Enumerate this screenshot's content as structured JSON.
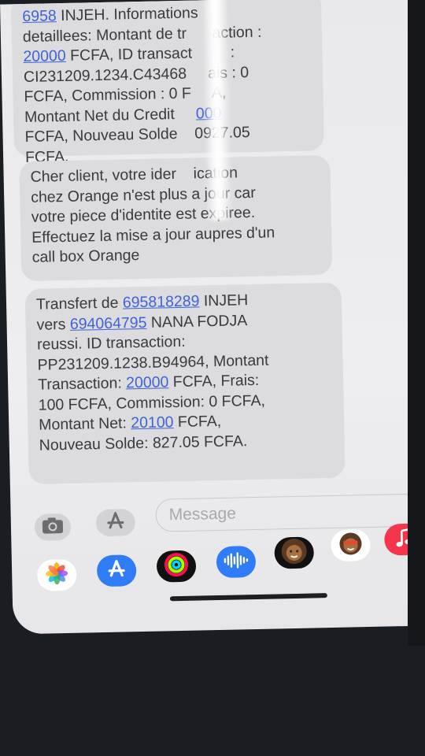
{
  "messages": [
    {
      "lines": [
        {
          "parts": [
            {
              "t": "6958",
              "link": true
            },
            {
              "t": " INJEH. Informations"
            }
          ]
        },
        {
          "parts": [
            {
              "t": "detaillees: Montant de tr"
            },
            {
              "t": "      "
            },
            {
              "t": "action :"
            }
          ]
        },
        {
          "parts": [
            {
              "t": "20000",
              "link": true
            },
            {
              "t": " FCFA, ID transact"
            },
            {
              "t": "         "
            },
            {
              "t": ":"
            }
          ]
        },
        {
          "parts": [
            {
              "t": "CI231209.1234.C43468"
            },
            {
              "t": "     "
            },
            {
              "t": "ais : 0"
            }
          ]
        },
        {
          "parts": [
            {
              "t": "FCFA, Commission : 0 F"
            },
            {
              "t": "     "
            },
            {
              "t": "A,"
            }
          ]
        },
        {
          "parts": [
            {
              "t": "Montant Net du Credit "
            },
            {
              "t": "    "
            },
            {
              "t": "000",
              "link": true
            }
          ]
        },
        {
          "parts": [
            {
              "t": "FCFA, Nouveau Solde "
            },
            {
              "t": "   "
            },
            {
              "t": "0927.05"
            }
          ]
        },
        {
          "parts": [
            {
              "t": "FCFA."
            }
          ]
        }
      ]
    },
    {
      "lines": [
        {
          "parts": [
            {
              "t": "Cher client, votre ider"
            },
            {
              "t": "    "
            },
            {
              "t": "ication"
            }
          ]
        },
        {
          "parts": [
            {
              "t": "chez Orange n'est plus a jour car"
            }
          ]
        },
        {
          "parts": [
            {
              "t": "votre piece d'identite est expiree."
            }
          ]
        },
        {
          "parts": [
            {
              "t": "Effectuez la mise a jour aupres d'un"
            }
          ]
        },
        {
          "parts": [
            {
              "t": "call box Orange"
            }
          ]
        }
      ]
    },
    {
      "lines": [
        {
          "parts": [
            {
              "t": "Transfert de "
            },
            {
              "t": "695818289",
              "link": true
            },
            {
              "t": " INJEH"
            }
          ]
        },
        {
          "parts": [
            {
              "t": "vers "
            },
            {
              "t": "694064795",
              "link": true
            },
            {
              "t": " NANA FODJA"
            }
          ]
        },
        {
          "parts": [
            {
              "t": "reussi. ID transaction:"
            }
          ]
        },
        {
          "parts": [
            {
              "t": "PP231209.1238.B94964, Montant"
            }
          ]
        },
        {
          "parts": [
            {
              "t": "Transaction: "
            },
            {
              "t": "20000",
              "link": true
            },
            {
              "t": " FCFA, Frais:"
            }
          ]
        },
        {
          "parts": [
            {
              "t": "100 FCFA, Commission: 0 FCFA,"
            }
          ]
        },
        {
          "parts": [
            {
              "t": "Montant Net: "
            },
            {
              "t": "20100",
              "link": true
            },
            {
              "t": " FCFA,"
            }
          ]
        },
        {
          "parts": [
            {
              "t": "Nouveau Solde: 827.05 FCFA."
            }
          ]
        }
      ]
    }
  ],
  "composer": {
    "placeholder": "Message",
    "camera_icon": "camera-icon",
    "apps_icon": "app-store-icon",
    "mic_icon": "microphone-icon"
  },
  "dock": [
    {
      "name": "photos-app-icon",
      "bg": "#ffffff"
    },
    {
      "name": "app-store-app-icon",
      "bg": "#2f7cf6"
    },
    {
      "name": "fitness-activity-icon",
      "bg": "#111111"
    },
    {
      "name": "audio-message-icon",
      "bg": "#2f7cf6"
    },
    {
      "name": "memoji-icon",
      "bg": "#111111"
    },
    {
      "name": "memoji-stickers-icon",
      "bg": "#ffffff"
    },
    {
      "name": "music-app-icon",
      "bg": "#f6354d"
    }
  ],
  "colors": {
    "bubble": "#dcdcdf",
    "link": "#3f63d6",
    "text": "#3a3a3e"
  }
}
